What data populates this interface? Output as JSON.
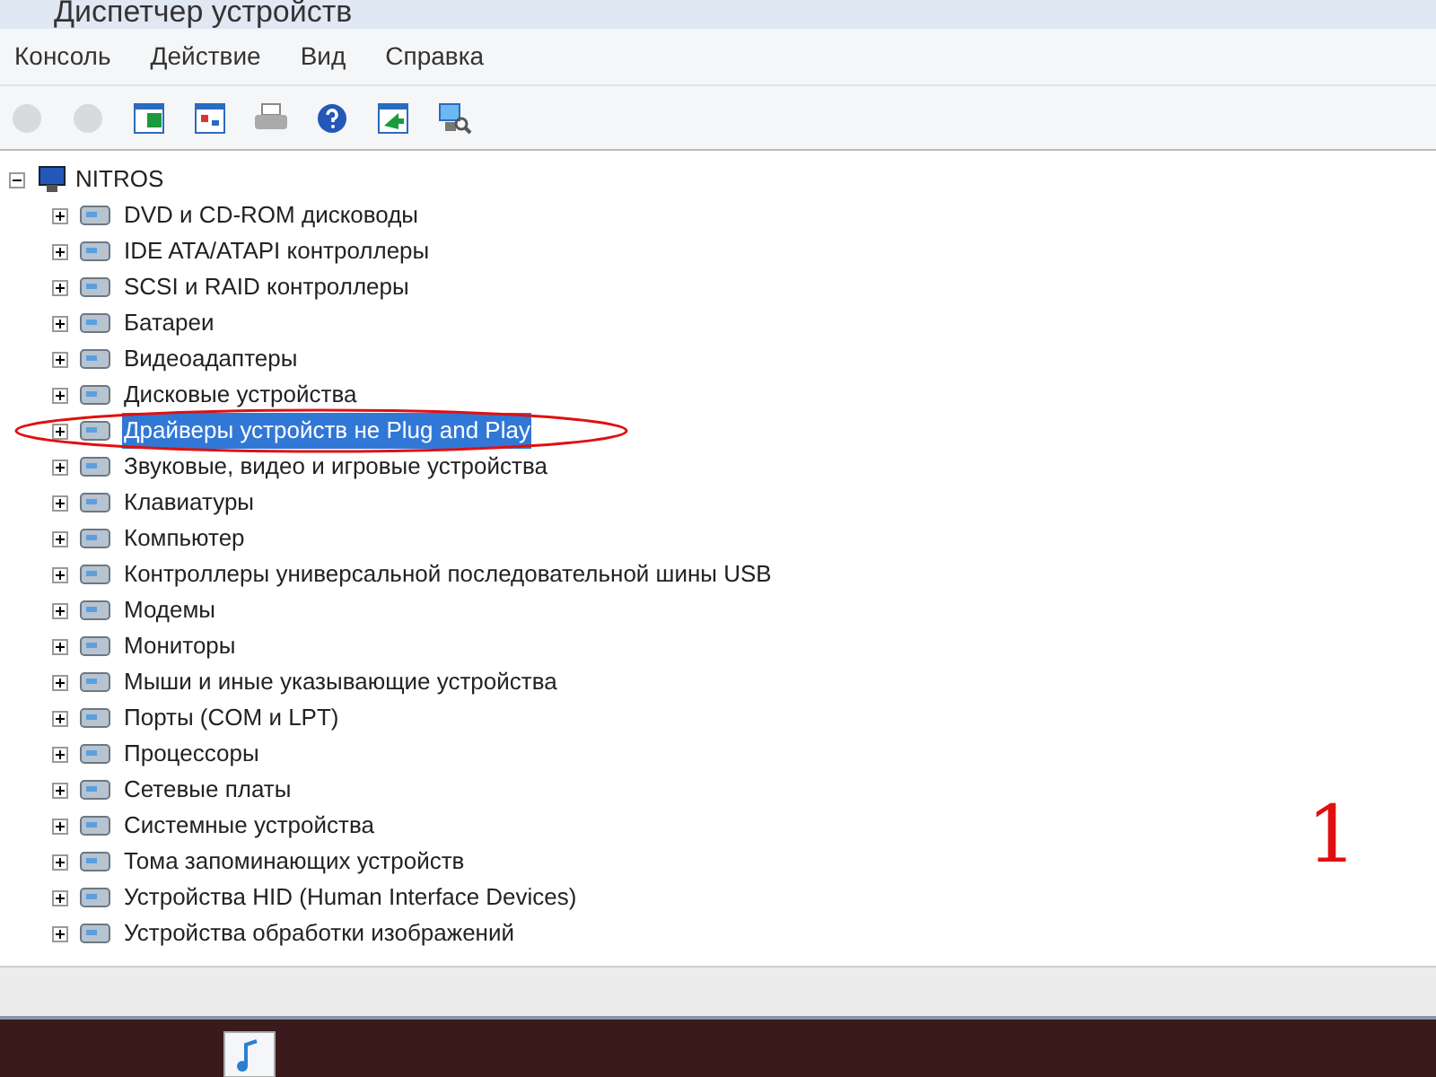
{
  "window": {
    "title": "Диспетчер устройств"
  },
  "menu": [
    "Консоль",
    "Действие",
    "Вид",
    "Справка"
  ],
  "toolbar": [
    {
      "kind": "back",
      "disabled": true
    },
    {
      "kind": "forward",
      "disabled": true
    },
    {
      "kind": "panel",
      "disabled": false
    },
    {
      "kind": "properties",
      "disabled": false
    },
    {
      "kind": "print",
      "disabled": false
    },
    {
      "kind": "help",
      "disabled": false
    },
    {
      "kind": "update",
      "disabled": false
    },
    {
      "kind": "scan",
      "disabled": false
    }
  ],
  "tree": {
    "label": "NITROS",
    "expanded": true,
    "children": [
      {
        "label": "DVD и CD-ROM дисководы",
        "selected": false
      },
      {
        "label": "IDE ATA/ATAPI контроллеры",
        "selected": false
      },
      {
        "label": "SCSI и RAID контроллеры",
        "selected": false
      },
      {
        "label": "Батареи",
        "selected": false
      },
      {
        "label": "Видеоадаптеры",
        "selected": false
      },
      {
        "label": "Дисковые устройства",
        "selected": false
      },
      {
        "label": "Драйверы устройств не Plug and Play",
        "selected": true
      },
      {
        "label": "Звуковые, видео и игровые устройства",
        "selected": false
      },
      {
        "label": "Клавиатуры",
        "selected": false
      },
      {
        "label": "Компьютер",
        "selected": false
      },
      {
        "label": "Контроллеры универсальной последовательной шины USB",
        "selected": false
      },
      {
        "label": "Модемы",
        "selected": false
      },
      {
        "label": "Мониторы",
        "selected": false
      },
      {
        "label": "Мыши и иные указывающие устройства",
        "selected": false
      },
      {
        "label": "Порты (COM и LPT)",
        "selected": false
      },
      {
        "label": "Процессоры",
        "selected": false
      },
      {
        "label": "Сетевые платы",
        "selected": false
      },
      {
        "label": "Системные устройства",
        "selected": false
      },
      {
        "label": "Тома запоминающих устройств",
        "selected": false
      },
      {
        "label": "Устройства HID (Human Interface Devices)",
        "selected": false
      },
      {
        "label": "Устройства обработки изображений",
        "selected": false
      }
    ]
  },
  "annotation": {
    "label": "1"
  }
}
